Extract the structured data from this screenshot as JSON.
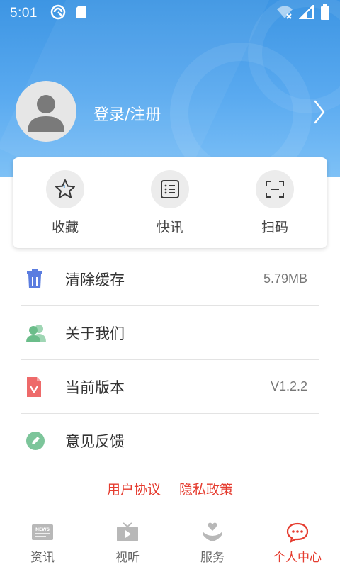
{
  "status_bar": {
    "time": "5:01"
  },
  "profile": {
    "login_label": "登录/注册"
  },
  "quick_actions": [
    {
      "label": "收藏",
      "icon": "star-icon"
    },
    {
      "label": "快讯",
      "icon": "list-icon"
    },
    {
      "label": "扫码",
      "icon": "scan-icon"
    }
  ],
  "menu": [
    {
      "label": "清除缓存",
      "value": "5.79MB",
      "icon": "trash-icon",
      "color": "#5b7de0"
    },
    {
      "label": "关于我们",
      "value": "",
      "icon": "users-icon",
      "color": "#7cc59a"
    },
    {
      "label": "当前版本",
      "value": "V1.2.2",
      "icon": "version-doc-icon",
      "color": "#ee6a6a"
    },
    {
      "label": "意见反馈",
      "value": "",
      "icon": "pencil-icon",
      "color": "#7cc59a"
    }
  ],
  "links": {
    "user_agreement": "用户协议",
    "privacy_policy": "隐私政策"
  },
  "tabs": [
    {
      "label": "资讯",
      "icon": "news-icon",
      "active": false
    },
    {
      "label": "视听",
      "icon": "tv-icon",
      "active": false
    },
    {
      "label": "服务",
      "icon": "service-icon",
      "active": false
    },
    {
      "label": "个人中心",
      "icon": "chat-icon",
      "active": true
    }
  ],
  "colors": {
    "accent": "#e53c2f",
    "header_blue": "#4a9fe8"
  }
}
